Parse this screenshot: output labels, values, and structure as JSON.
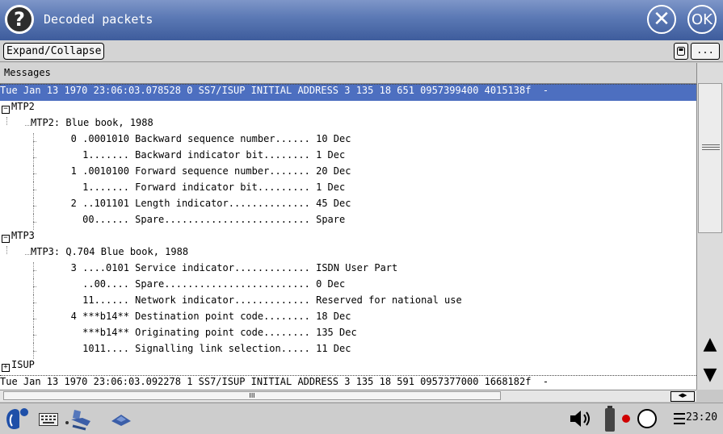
{
  "window": {
    "title": "Decoded packets",
    "help_glyph": "?",
    "close_glyph": "✕",
    "ok_label": "OK"
  },
  "toolbar": {
    "expand_collapse_label": "Expand/Collapse",
    "more_label": "..."
  },
  "list": {
    "header": "Messages",
    "rows": [
      {
        "text": "Tue Jan 13 1970 23:06:03.078528 0 SS7/ISUP INITIAL ADDRESS 3 135 18 651 0957399400 4015138f  -",
        "kind": "message",
        "selected": true
      },
      {
        "text": "MTP2",
        "kind": "group",
        "toggle": "−"
      },
      {
        "text": "MTP2: Blue book, 1988",
        "kind": "sub"
      },
      {
        "text": "   0 .0001010 Backward sequence number...... 10 Dec",
        "kind": "field"
      },
      {
        "text": "     1....... Backward indicator bit........ 1 Dec",
        "kind": "field"
      },
      {
        "text": "   1 .0010100 Forward sequence number....... 20 Dec",
        "kind": "field"
      },
      {
        "text": "     1....... Forward indicator bit......... 1 Dec",
        "kind": "field"
      },
      {
        "text": "   2 ..101101 Length indicator.............. 45 Dec",
        "kind": "field"
      },
      {
        "text": "     00...... Spare......................... Spare",
        "kind": "field"
      },
      {
        "text": "MTP3",
        "kind": "group",
        "toggle": "−"
      },
      {
        "text": "MTP3: Q.704 Blue book, 1988",
        "kind": "sub"
      },
      {
        "text": "   3 ....0101 Service indicator............. ISDN User Part",
        "kind": "field"
      },
      {
        "text": "     ..00.... Spare......................... 0 Dec",
        "kind": "field"
      },
      {
        "text": "     11...... Network indicator............. Reserved for national use",
        "kind": "field"
      },
      {
        "text": "   4 ***b14** Destination point code........ 18 Dec",
        "kind": "field"
      },
      {
        "text": "     ***b14** Originating point code........ 135 Dec",
        "kind": "field"
      },
      {
        "text": "     1011.... Signalling link selection..... 11 Dec",
        "kind": "field"
      },
      {
        "text": "ISUP",
        "kind": "group",
        "toggle": "+"
      },
      {
        "text": "Tue Jan 13 1970 23:06:03.092278 1 SS7/ISUP INITIAL ADDRESS 3 135 18 591 0957377000 1668182f  -",
        "kind": "message",
        "selected": false
      }
    ]
  },
  "scroll": {
    "hgrip": "III",
    "harrows": "◀▶"
  },
  "taskbar": {
    "clock": "23:20",
    "icons": [
      "start-menu-icon",
      "keyboard-icon",
      "handwriting-icon",
      "launcher-icon",
      "volume-icon",
      "battery-icon",
      "record-icon",
      "power-icon",
      "menu-icon"
    ]
  },
  "colors": {
    "titlebar": "#5a78b4",
    "selection": "#4d6fc0"
  }
}
